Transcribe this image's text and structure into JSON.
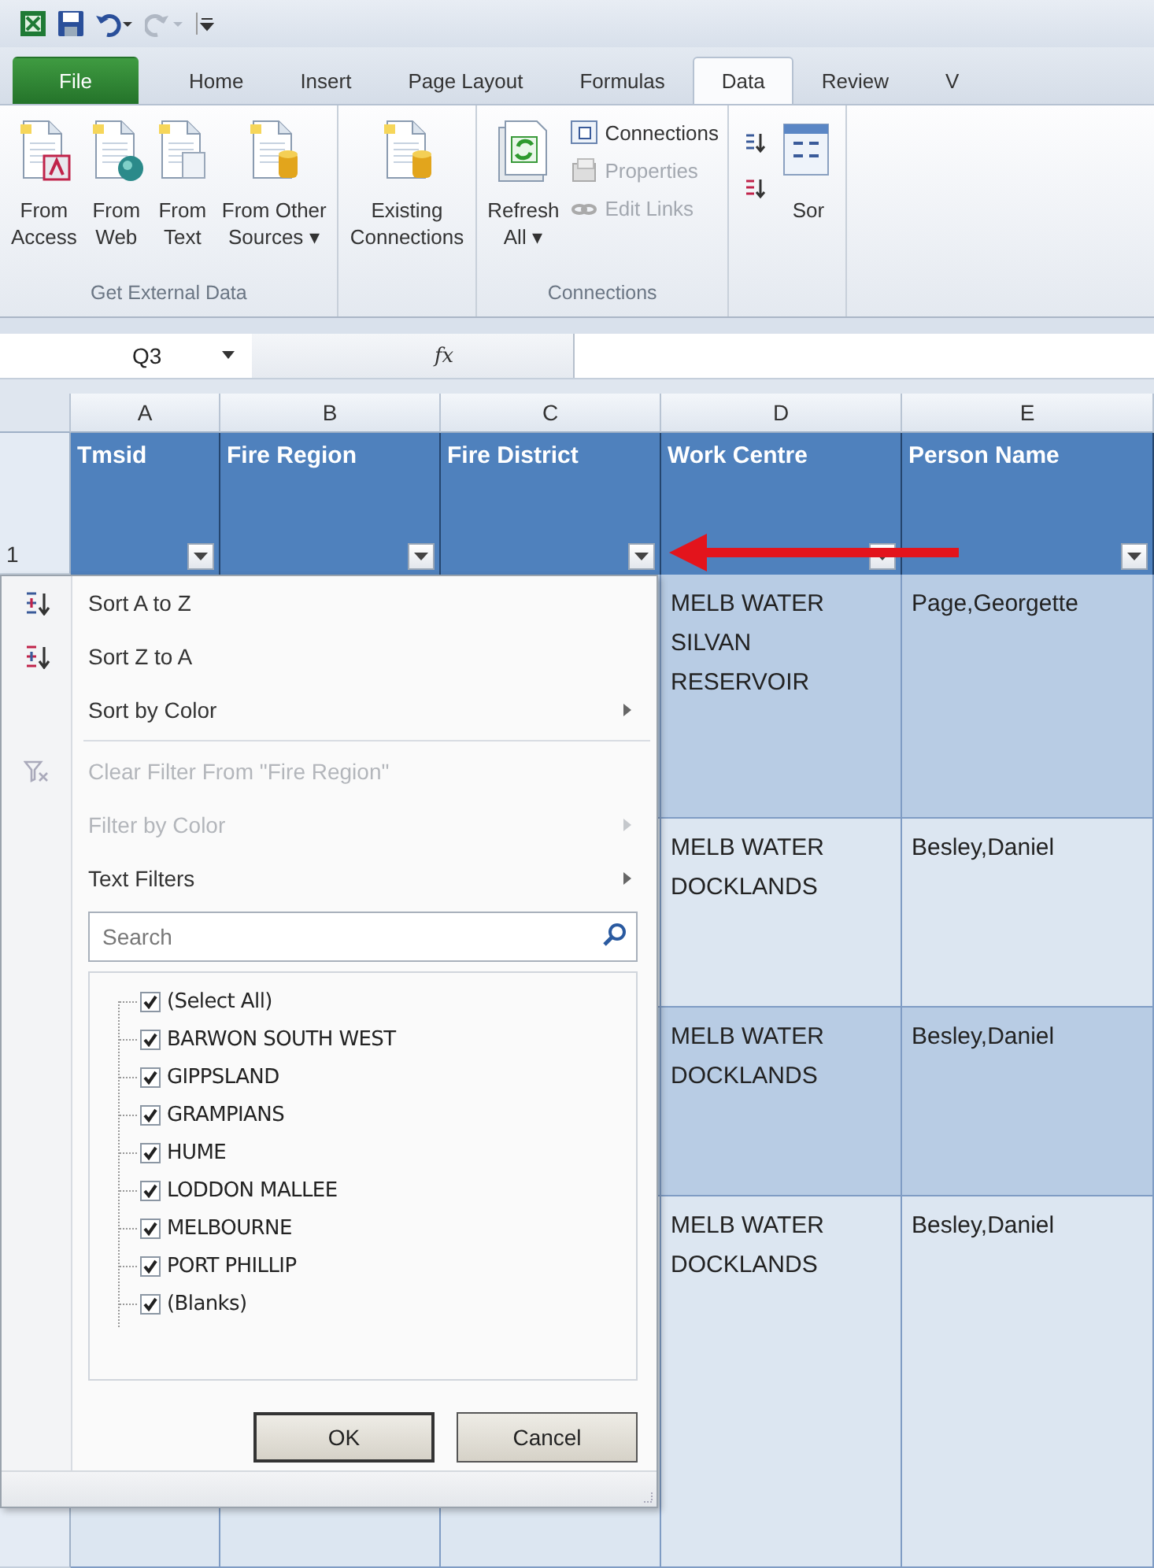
{
  "ribbon": {
    "tabs": [
      {
        "label": "File",
        "kind": "file",
        "selected": false
      },
      {
        "label": "Home",
        "kind": "tab",
        "selected": false
      },
      {
        "label": "Insert",
        "kind": "tab",
        "selected": false
      },
      {
        "label": "Page Layout",
        "kind": "tab",
        "selected": false
      },
      {
        "label": "Formulas",
        "kind": "tab",
        "selected": false
      },
      {
        "label": "Data",
        "kind": "tab",
        "selected": true
      },
      {
        "label": "Review",
        "kind": "tab",
        "selected": false
      },
      {
        "label": "V",
        "kind": "tab",
        "selected": false
      }
    ],
    "groups": [
      {
        "label": "Get External Data",
        "buttons": [
          {
            "kind": "large",
            "label": "From\nAccess",
            "disabled": false
          },
          {
            "kind": "large",
            "label": "From\nWeb",
            "disabled": false
          },
          {
            "kind": "large",
            "label": "From\nText",
            "disabled": false
          },
          {
            "kind": "large",
            "label": "From Other\nSources ▾",
            "disabled": false
          }
        ]
      },
      {
        "buttons": [
          {
            "kind": "large",
            "label": "Existing\nConnections",
            "disabled": false
          }
        ]
      },
      {
        "label": "Connections",
        "buttons": [
          {
            "kind": "large",
            "label": "Refresh\nAll ▾",
            "disabled": false
          },
          {
            "kind": "small",
            "label": "Connections",
            "disabled": false
          },
          {
            "kind": "small",
            "label": "Properties",
            "disabled": true
          },
          {
            "kind": "small",
            "label": "Edit Links",
            "disabled": true
          }
        ]
      },
      {
        "buttons": [
          {
            "kind": "icon_pair",
            "disabled": false
          },
          {
            "kind": "large",
            "label": "Sor",
            "disabled": false
          }
        ]
      }
    ]
  },
  "formula_bar": {
    "name_box": "Q3",
    "function_label": "fx"
  },
  "sheet": {
    "columns": [
      "A",
      "B",
      "C",
      "D",
      "E"
    ],
    "header_row": {
      "number": "1",
      "cells": [
        "Tmsid",
        "Fire Region",
        "Fire District",
        "Work Centre",
        "Person Name"
      ]
    },
    "rows": [
      {
        "work_centre": "MELB WATER\nSILVAN\nRESERVOIR",
        "person_name": "Page,Georgette"
      },
      {
        "work_centre": "MELB WATER\nDOCKLANDS",
        "person_name": "Besley,Daniel"
      },
      {
        "work_centre": "MELB WATER\nDOCKLANDS",
        "person_name": "Besley,Daniel"
      },
      {
        "work_centre": "MELB WATER\nDOCKLANDS",
        "person_name": "Besley,Daniel"
      }
    ]
  },
  "filter_menu": {
    "items": [
      {
        "kind": "command",
        "label": "Sort A to Z",
        "disabled": false,
        "submenu": false
      },
      {
        "kind": "command",
        "label": "Sort Z to A",
        "disabled": false,
        "submenu": false
      },
      {
        "kind": "command",
        "label": "Sort by Color",
        "disabled": false,
        "submenu": true
      },
      {
        "kind": "separator"
      },
      {
        "kind": "command",
        "label": "Clear Filter From \"Fire Region\"",
        "disabled": true,
        "submenu": false
      },
      {
        "kind": "command",
        "label": "Filter by Color",
        "disabled": true,
        "submenu": true
      },
      {
        "kind": "command",
        "label": "Text Filters",
        "disabled": false,
        "submenu": true
      }
    ],
    "search": {
      "placeholder": "Search"
    },
    "values": [
      {
        "label": "(Select All)",
        "checked": true
      },
      {
        "label": "BARWON SOUTH WEST",
        "checked": true
      },
      {
        "label": "GIPPSLAND",
        "checked": true
      },
      {
        "label": "GRAMPIANS",
        "checked": true
      },
      {
        "label": "HUME",
        "checked": true
      },
      {
        "label": "LODDON MALLEE",
        "checked": true
      },
      {
        "label": "MELBOURNE",
        "checked": true
      },
      {
        "label": "PORT PHILLIP",
        "checked": true
      },
      {
        "label": "(Blanks)",
        "checked": true
      }
    ],
    "buttons": [
      "OK",
      "Cancel"
    ]
  }
}
